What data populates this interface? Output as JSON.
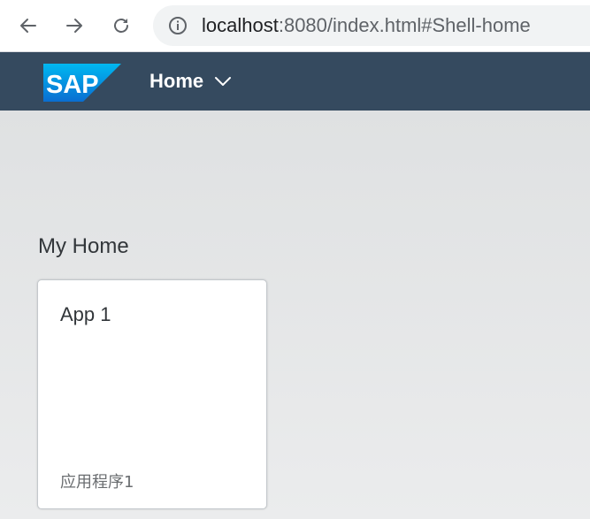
{
  "browser": {
    "url_host": "localhost",
    "url_rest": ":8080/index.html#Shell-home"
  },
  "shell": {
    "logo_text": "SAP",
    "home_title": "Home"
  },
  "main": {
    "section_title": "My Home",
    "tiles": [
      {
        "title": "App 1",
        "footer": "应用程序1"
      }
    ]
  },
  "colors": {
    "shell_bar": "#354a5f",
    "sap_logo_blue": "#0a6ed1"
  },
  "icons": {
    "back": "arrow-left-icon",
    "forward": "arrow-right-icon",
    "reload": "reload-icon",
    "site_info": "info-icon",
    "menu": "chevron-down-icon"
  }
}
